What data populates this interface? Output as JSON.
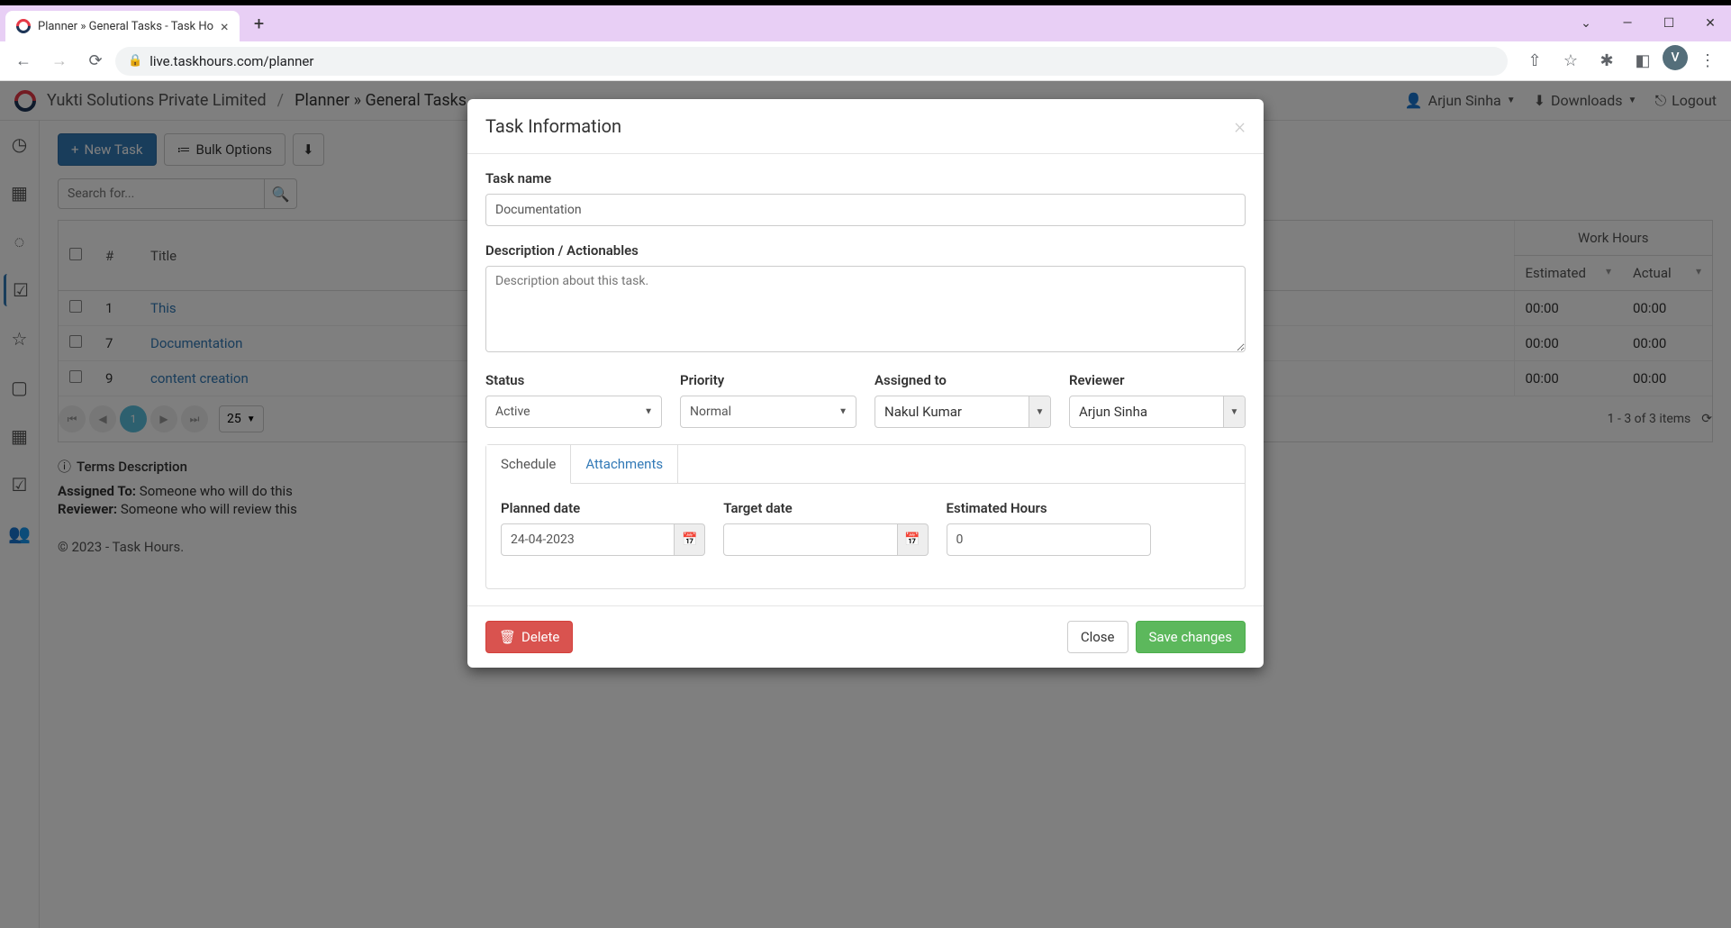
{
  "browser": {
    "tab_title": "Planner » General Tasks - Task Ho",
    "url": "live.taskhours.com/planner",
    "avatar_letter": "V"
  },
  "header": {
    "org": "Yukti Solutions Private Limited",
    "breadcrumb": "Planner » General Tasks",
    "user": "Arjun Sinha",
    "downloads": "Downloads",
    "logout": "Logout"
  },
  "toolbar": {
    "new_task": "New Task",
    "bulk_options": "Bulk Options"
  },
  "search": {
    "placeholder": "Search for..."
  },
  "table": {
    "headers": {
      "num": "#",
      "title": "Title",
      "work_hours": "Work Hours",
      "estimated": "Estimated",
      "actual": "Actual"
    },
    "rows": [
      {
        "num": "1",
        "title": "This",
        "estimated": "00:00",
        "actual": "00:00"
      },
      {
        "num": "7",
        "title": "Documentation",
        "estimated": "00:00",
        "actual": "00:00"
      },
      {
        "num": "9",
        "title": "content creation",
        "estimated": "00:00",
        "actual": "00:00"
      }
    ]
  },
  "pager": {
    "page": "1",
    "size": "25",
    "info": "1 - 3 of 3 items"
  },
  "terms": {
    "title": "Terms Description",
    "assigned_label": "Assigned To:",
    "assigned_text": "Someone who will do this",
    "reviewer_label": "Reviewer:",
    "reviewer_text": "Someone who will review this"
  },
  "footer": "© 2023 - Task Hours.",
  "modal": {
    "title": "Task Information",
    "task_name_label": "Task name",
    "task_name_value": "Documentation",
    "description_label": "Description / Actionables",
    "description_placeholder": "Description about this task.",
    "status_label": "Status",
    "status_value": "Active",
    "priority_label": "Priority",
    "priority_value": "Normal",
    "assigned_label": "Assigned to",
    "assigned_value": "Nakul Kumar",
    "reviewer_label": "Reviewer",
    "reviewer_value": "Arjun Sinha",
    "tab_schedule": "Schedule",
    "tab_attachments": "Attachments",
    "planned_label": "Planned date",
    "planned_value": "24-04-2023",
    "target_label": "Target date",
    "target_value": "",
    "est_label": "Estimated Hours",
    "est_value": "0",
    "delete": "Delete",
    "close": "Close",
    "save": "Save changes"
  }
}
